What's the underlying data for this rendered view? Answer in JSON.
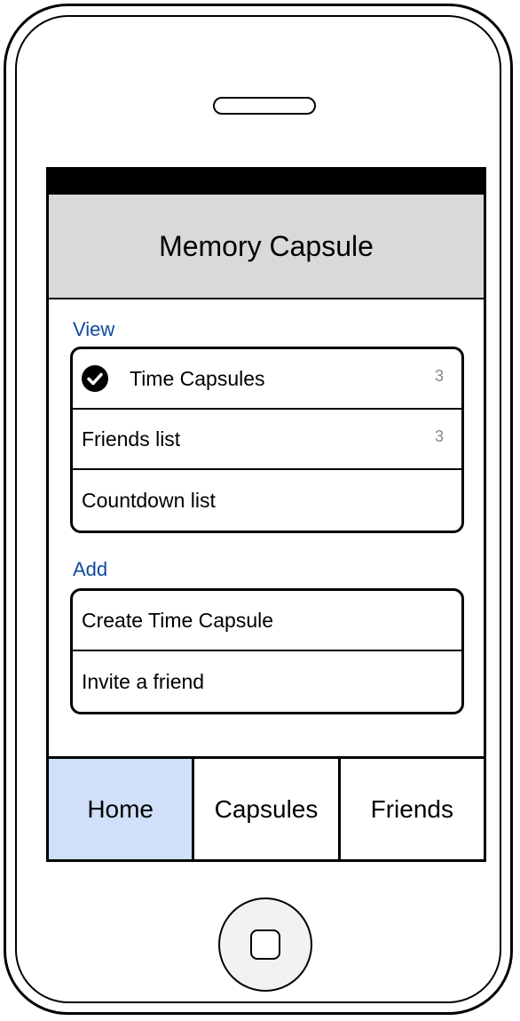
{
  "app": {
    "title": "Memory Capsule"
  },
  "view_section": {
    "label": "View",
    "items": [
      {
        "label": "Time Capsules",
        "count": "3",
        "checked": true
      },
      {
        "label": "Friends list",
        "count": "3"
      },
      {
        "label": "Countdown list",
        "count": ""
      }
    ]
  },
  "add_section": {
    "label": "Add",
    "items": [
      {
        "label": "Create Time Capsule"
      },
      {
        "label": "Invite a friend"
      }
    ]
  },
  "tabs": [
    {
      "label": "Home",
      "active": true
    },
    {
      "label": "Capsules",
      "active": false
    },
    {
      "label": "Friends",
      "active": false
    }
  ],
  "icons": {
    "check": "check-circle-icon",
    "home_button": "home-button-icon"
  },
  "colors": {
    "section_label": "#0e4a9e",
    "nav_bar_bg": "#d9d9d9",
    "active_tab_bg": "#cfe0f8",
    "count_text": "#888888"
  }
}
